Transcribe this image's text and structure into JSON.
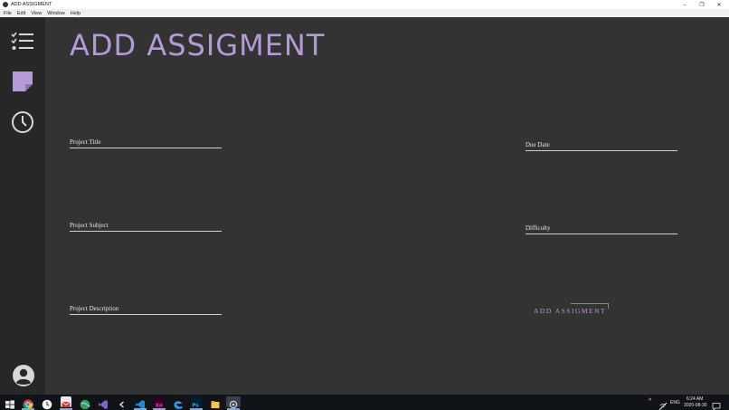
{
  "window": {
    "title": "ADD ASSIGMENT",
    "controls": {
      "minimize": "–",
      "maximize": "❐",
      "close": "✕"
    }
  },
  "menu": [
    "File",
    "Edit",
    "View",
    "Window",
    "Help"
  ],
  "sidebar": {
    "items": [
      {
        "icon": "checklist-icon"
      },
      {
        "icon": "sticky-note-icon",
        "active": true
      },
      {
        "icon": "clock-icon"
      },
      {
        "icon": "account-icon"
      }
    ]
  },
  "page": {
    "title": "ADD ASSIGMENT",
    "fields": {
      "project_title": {
        "label": "Project Title",
        "value": ""
      },
      "project_subject": {
        "label": "Project Subject",
        "value": ""
      },
      "project_description": {
        "label": "Project Description",
        "value": ""
      },
      "due_date": {
        "label": "Due Date",
        "value": ""
      },
      "difficulty": {
        "label": "Difficulty",
        "value": ""
      }
    },
    "submit_label": "ADD ASSIGMENT"
  },
  "taskbar": {
    "apps": [
      "windows-start-icon",
      "chrome-icon",
      "clock-app-icon",
      "mail-icon",
      "globe-icon",
      "visual-studio-icon",
      "back-arrow-icon",
      "vscode-icon",
      "adobe-xd-icon",
      "edge-icon",
      "photoshop-icon",
      "file-explorer-icon",
      "java-app-icon"
    ],
    "tray": {
      "chevron": "^",
      "lang": "ENG",
      "time": "6:24 AM",
      "date": "2020-08-30"
    }
  },
  "colors": {
    "accent": "#b49ad6",
    "sidebar": "#272727",
    "main": "#333333"
  }
}
